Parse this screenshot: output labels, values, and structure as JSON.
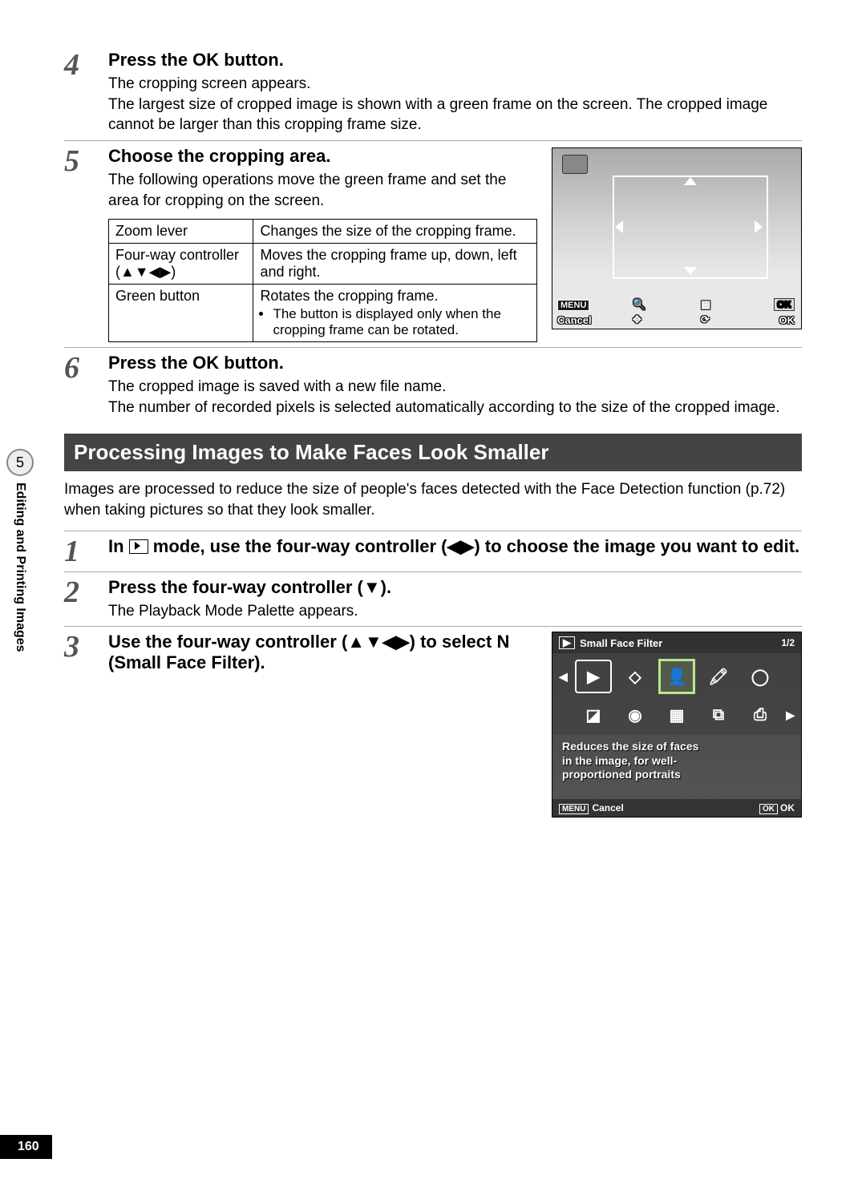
{
  "sidebar": {
    "chapter_number": "5",
    "chapter_title": "Editing and Printing Images"
  },
  "page_number": "160",
  "step4": {
    "num": "4",
    "title_pre": "Press the ",
    "title_ok": "OK",
    "title_post": " button.",
    "line1": "The cropping screen appears.",
    "line2": "The largest size of cropped image is shown with a green frame on the screen. The cropped image cannot be larger than this cropping frame size."
  },
  "step5": {
    "num": "5",
    "title": "Choose the cropping area.",
    "intro": "The following operations move the green frame and set the area for cropping on the screen.",
    "table": {
      "r1c1": "Zoom lever",
      "r1c2": "Changes the size of the cropping frame.",
      "r2c1": "Four-way controller (▲▼◀▶)",
      "r2c2": "Moves the cropping frame up, down, left and right.",
      "r3c1": "Green button",
      "r3c2": "Rotates the cropping frame.",
      "r3c2_note": "The button is displayed only when the cropping frame can be rotated."
    },
    "screenshot": {
      "menu": "MENU",
      "cancel": "Cancel",
      "ok_box": "OK",
      "ok_text": "OK"
    }
  },
  "step6": {
    "num": "6",
    "title_pre": "Press the ",
    "title_ok": "OK",
    "title_post": " button.",
    "line1": "The cropped image is saved with a new file name.",
    "line2": "The number of recorded pixels is selected automatically according to the size of the cropped image."
  },
  "section": {
    "title": "Processing Images to Make Faces Look Smaller",
    "intro": "Images are processed to reduce the size of people's faces detected with the Face Detection function (p.72) when taking pictures so that they look smaller."
  },
  "sstep1": {
    "num": "1",
    "title": "In  Q  mode, use the four-way controller (◀▶) to choose the image you want to edit.",
    "title_pre": "In ",
    "title_mid": " mode, use the four-way controller (◀▶) to choose the image you want to edit."
  },
  "sstep2": {
    "num": "2",
    "title": "Press the four-way controller (▼).",
    "body": "The Playback Mode Palette appears."
  },
  "sstep3": {
    "num": "3",
    "title": "Use the four-way controller (▲▼◀▶) to select N (Small Face Filter).",
    "screenshot": {
      "title": "Small Face Filter",
      "count": "1/2",
      "desc1": "Reduces the size of faces",
      "desc2": "in the image, for well-",
      "desc3": "proportioned portraits",
      "menu": "MENU",
      "cancel": "Cancel",
      "ok_box": "OK",
      "ok_text": "OK"
    }
  }
}
